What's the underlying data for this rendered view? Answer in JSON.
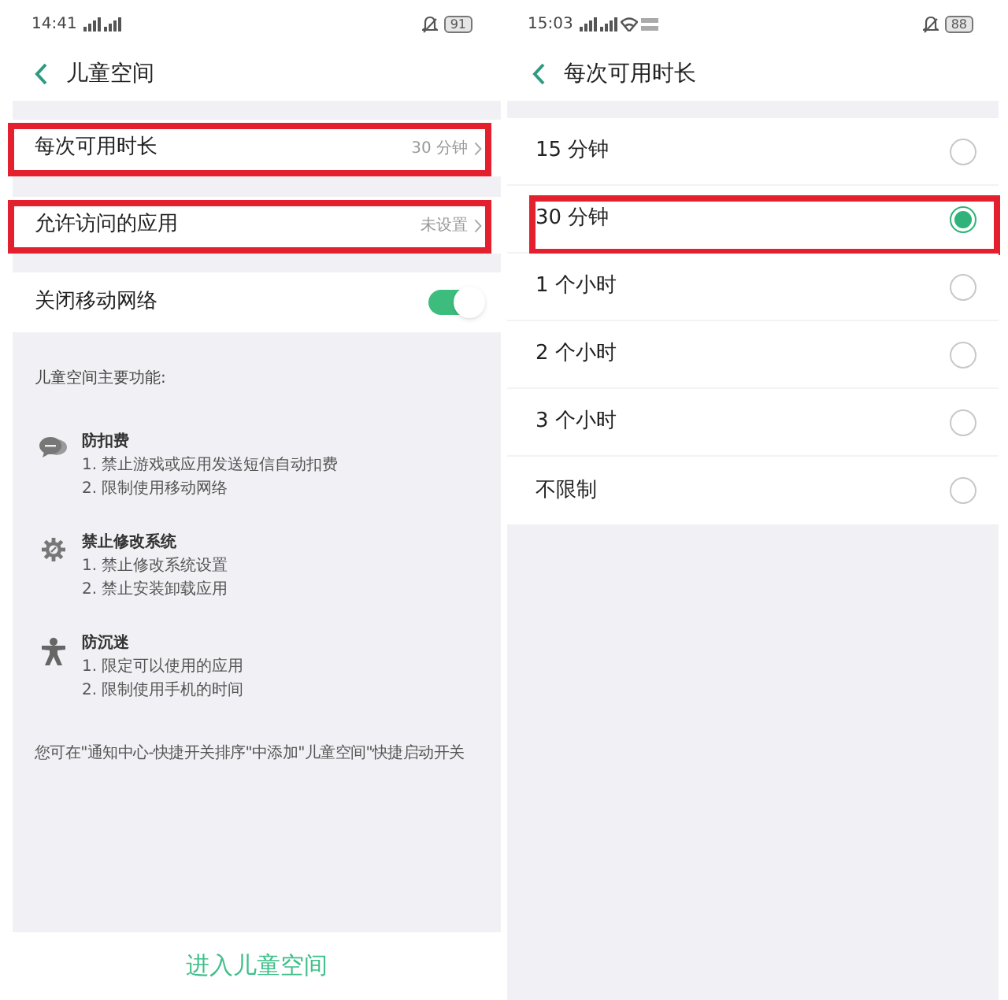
{
  "left_screen": {
    "status_bar": {
      "time": "14:41",
      "battery": "91"
    },
    "header": {
      "title": "儿童空间"
    },
    "settings": [
      {
        "kind": "link",
        "label": "每次可用时长",
        "value": "30 分钟",
        "highlighted": true
      },
      {
        "kind": "link",
        "label": "允许访问的应用",
        "value": "未设置",
        "highlighted": true
      },
      {
        "kind": "toggle",
        "label": "关闭移动网络",
        "on": true,
        "highlighted": false
      }
    ],
    "features": {
      "heading": "儿童空间主要功能:",
      "items": [
        {
          "title": "防扣费",
          "lines": [
            "1. 禁止游戏或应用发送短信自动扣费",
            "2. 限制使用移动网络"
          ]
        },
        {
          "title": "禁止修改系统",
          "lines": [
            "1. 禁止修改系统设置",
            "2. 禁止安装卸载应用"
          ]
        },
        {
          "title": "防沉迷",
          "lines": [
            "1. 限定可以使用的应用",
            "2. 限制使用手机的时间"
          ]
        }
      ],
      "note": "您可在\"通知中心-快捷开关排序\"中添加\"儿童空间\"快捷启动开关"
    },
    "primary_button": {
      "label": "进入儿童空间"
    }
  },
  "right_screen": {
    "status_bar": {
      "time": "15:03",
      "battery": "88"
    },
    "header": {
      "title": "每次可用时长"
    },
    "options": [
      {
        "label": "15 分钟",
        "selected": false,
        "highlighted": false
      },
      {
        "label": "30 分钟",
        "selected": true,
        "highlighted": true
      },
      {
        "label": "1 个小时",
        "selected": false,
        "highlighted": false
      },
      {
        "label": "2 个小时",
        "selected": false,
        "highlighted": false
      },
      {
        "label": "3 个小时",
        "selected": false,
        "highlighted": false
      },
      {
        "label": "不限制",
        "selected": false,
        "highlighted": false
      }
    ]
  }
}
